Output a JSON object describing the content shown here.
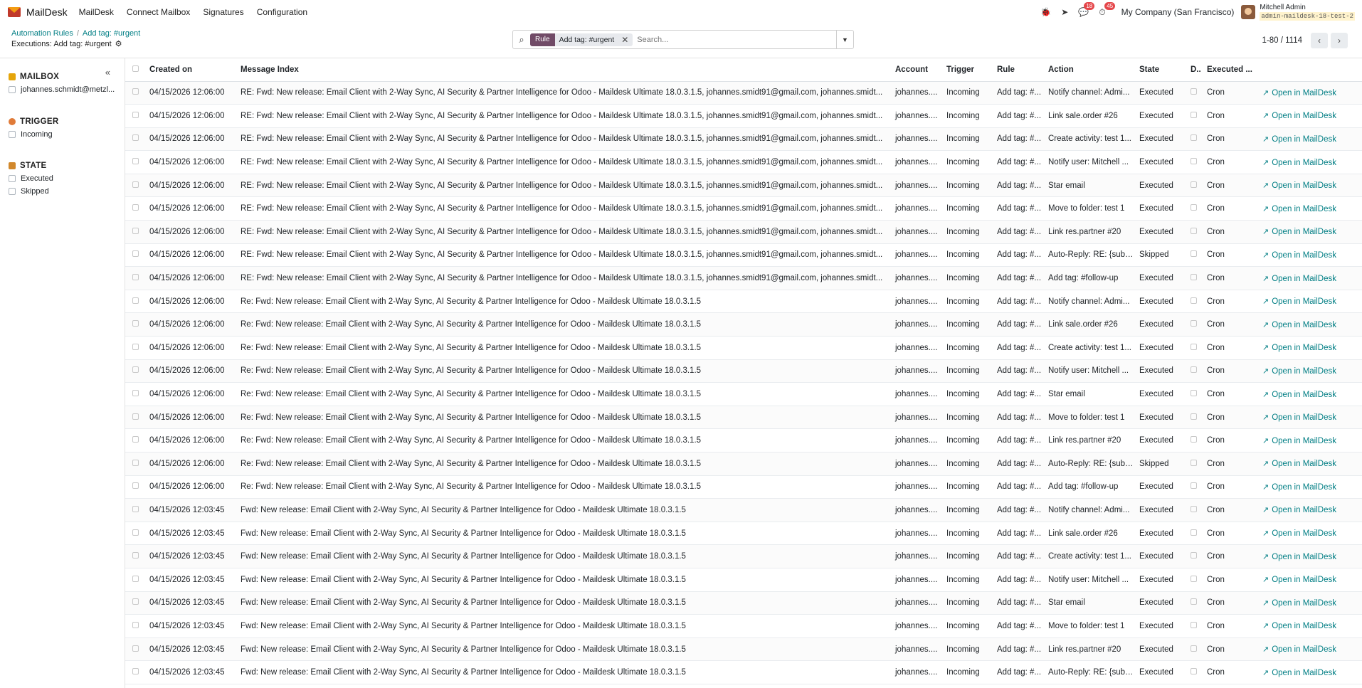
{
  "app": {
    "name": "MailDesk",
    "menu": [
      "MailDesk",
      "Connect Mailbox",
      "Signatures",
      "Configuration"
    ]
  },
  "systray": {
    "messages_count": "18",
    "activities_count": "45",
    "company": "My Company (San Francisco)",
    "user_name": "Mitchell Admin",
    "database": "admin-maildesk-18-test-2"
  },
  "breadcrumb": {
    "root": "Automation Rules",
    "current": "Add tag: #urgent"
  },
  "subtitle": "Executions: Add tag: #urgent",
  "search": {
    "facet_label": "Rule",
    "facet_value": "Add tag: #urgent",
    "placeholder": "Search..."
  },
  "pager": {
    "value": "1-80 / 1114"
  },
  "sidebar": {
    "mailbox_title": "MAILBOX",
    "mailbox_items": [
      "johannes.schmidt@metzl..."
    ],
    "trigger_title": "TRIGGER",
    "trigger_items": [
      "Incoming"
    ],
    "state_title": "STATE",
    "state_items": [
      "Executed",
      "Skipped"
    ]
  },
  "colors": {
    "accent": "#714b67",
    "link": "#017e84",
    "brand": "#c0392b"
  },
  "table": {
    "headers": {
      "created_on": "Created on",
      "message_index": "Message Index",
      "account": "Account",
      "trigger": "Trigger",
      "rule": "Rule",
      "action": "Action",
      "state": "State",
      "d": "D..",
      "executed": "Executed ..."
    },
    "open_label": "Open in MailDesk",
    "rows": [
      {
        "created": "04/15/2026 12:06:00",
        "msg": "RE: Fwd: New release: Email Client with 2-Way Sync, AI Security & Partner Intelligence for Odoo - Maildesk Ultimate 18.0.3.1.5, johannes.smidt91@gmail.com, johannes.smidt...",
        "account": "johannes....",
        "trigger": "Incoming",
        "rule": "Add tag: #...",
        "action": "Notify channel: Admi...",
        "state": "Executed",
        "exec": "Cron"
      },
      {
        "created": "04/15/2026 12:06:00",
        "msg": "RE: Fwd: New release: Email Client with 2-Way Sync, AI Security & Partner Intelligence for Odoo - Maildesk Ultimate 18.0.3.1.5, johannes.smidt91@gmail.com, johannes.smidt...",
        "account": "johannes....",
        "trigger": "Incoming",
        "rule": "Add tag: #...",
        "action": "Link sale.order #26",
        "state": "Executed",
        "exec": "Cron"
      },
      {
        "created": "04/15/2026 12:06:00",
        "msg": "RE: Fwd: New release: Email Client with 2-Way Sync, AI Security & Partner Intelligence for Odoo - Maildesk Ultimate 18.0.3.1.5, johannes.smidt91@gmail.com, johannes.smidt...",
        "account": "johannes....",
        "trigger": "Incoming",
        "rule": "Add tag: #...",
        "action": "Create activity: test 1...",
        "state": "Executed",
        "exec": "Cron"
      },
      {
        "created": "04/15/2026 12:06:00",
        "msg": "RE: Fwd: New release: Email Client with 2-Way Sync, AI Security & Partner Intelligence for Odoo - Maildesk Ultimate 18.0.3.1.5, johannes.smidt91@gmail.com, johannes.smidt...",
        "account": "johannes....",
        "trigger": "Incoming",
        "rule": "Add tag: #...",
        "action": "Notify user: Mitchell ...",
        "state": "Executed",
        "exec": "Cron"
      },
      {
        "created": "04/15/2026 12:06:00",
        "msg": "RE: Fwd: New release: Email Client with 2-Way Sync, AI Security & Partner Intelligence for Odoo - Maildesk Ultimate 18.0.3.1.5, johannes.smidt91@gmail.com, johannes.smidt...",
        "account": "johannes....",
        "trigger": "Incoming",
        "rule": "Add tag: #...",
        "action": "Star email",
        "state": "Executed",
        "exec": "Cron"
      },
      {
        "created": "04/15/2026 12:06:00",
        "msg": "RE: Fwd: New release: Email Client with 2-Way Sync, AI Security & Partner Intelligence for Odoo - Maildesk Ultimate 18.0.3.1.5, johannes.smidt91@gmail.com, johannes.smidt...",
        "account": "johannes....",
        "trigger": "Incoming",
        "rule": "Add tag: #...",
        "action": "Move to folder: test 1",
        "state": "Executed",
        "exec": "Cron"
      },
      {
        "created": "04/15/2026 12:06:00",
        "msg": "RE: Fwd: New release: Email Client with 2-Way Sync, AI Security & Partner Intelligence for Odoo - Maildesk Ultimate 18.0.3.1.5, johannes.smidt91@gmail.com, johannes.smidt...",
        "account": "johannes....",
        "trigger": "Incoming",
        "rule": "Add tag: #...",
        "action": "Link res.partner #20",
        "state": "Executed",
        "exec": "Cron"
      },
      {
        "created": "04/15/2026 12:06:00",
        "msg": "RE: Fwd: New release: Email Client with 2-Way Sync, AI Security & Partner Intelligence for Odoo - Maildesk Ultimate 18.0.3.1.5, johannes.smidt91@gmail.com, johannes.smidt...",
        "account": "johannes....",
        "trigger": "Incoming",
        "rule": "Add tag: #...",
        "action": "Auto-Reply: RE: {subj...",
        "state": "Skipped",
        "exec": "Cron"
      },
      {
        "created": "04/15/2026 12:06:00",
        "msg": "RE: Fwd: New release: Email Client with 2-Way Sync, AI Security & Partner Intelligence for Odoo - Maildesk Ultimate 18.0.3.1.5, johannes.smidt91@gmail.com, johannes.smidt...",
        "account": "johannes....",
        "trigger": "Incoming",
        "rule": "Add tag: #...",
        "action": "Add tag: #follow-up",
        "state": "Executed",
        "exec": "Cron"
      },
      {
        "created": "04/15/2026 12:06:00",
        "msg": "Re: Fwd: New release: Email Client with 2-Way Sync, AI Security & Partner Intelligence for Odoo - Maildesk Ultimate 18.0.3.1.5",
        "account": "johannes....",
        "trigger": "Incoming",
        "rule": "Add tag: #...",
        "action": "Notify channel: Admi...",
        "state": "Executed",
        "exec": "Cron"
      },
      {
        "created": "04/15/2026 12:06:00",
        "msg": "Re: Fwd: New release: Email Client with 2-Way Sync, AI Security & Partner Intelligence for Odoo - Maildesk Ultimate 18.0.3.1.5",
        "account": "johannes....",
        "trigger": "Incoming",
        "rule": "Add tag: #...",
        "action": "Link sale.order #26",
        "state": "Executed",
        "exec": "Cron"
      },
      {
        "created": "04/15/2026 12:06:00",
        "msg": "Re: Fwd: New release: Email Client with 2-Way Sync, AI Security & Partner Intelligence for Odoo - Maildesk Ultimate 18.0.3.1.5",
        "account": "johannes....",
        "trigger": "Incoming",
        "rule": "Add tag: #...",
        "action": "Create activity: test 1...",
        "state": "Executed",
        "exec": "Cron"
      },
      {
        "created": "04/15/2026 12:06:00",
        "msg": "Re: Fwd: New release: Email Client with 2-Way Sync, AI Security & Partner Intelligence for Odoo - Maildesk Ultimate 18.0.3.1.5",
        "account": "johannes....",
        "trigger": "Incoming",
        "rule": "Add tag: #...",
        "action": "Notify user: Mitchell ...",
        "state": "Executed",
        "exec": "Cron"
      },
      {
        "created": "04/15/2026 12:06:00",
        "msg": "Re: Fwd: New release: Email Client with 2-Way Sync, AI Security & Partner Intelligence for Odoo - Maildesk Ultimate 18.0.3.1.5",
        "account": "johannes....",
        "trigger": "Incoming",
        "rule": "Add tag: #...",
        "action": "Star email",
        "state": "Executed",
        "exec": "Cron"
      },
      {
        "created": "04/15/2026 12:06:00",
        "msg": "Re: Fwd: New release: Email Client with 2-Way Sync, AI Security & Partner Intelligence for Odoo - Maildesk Ultimate 18.0.3.1.5",
        "account": "johannes....",
        "trigger": "Incoming",
        "rule": "Add tag: #...",
        "action": "Move to folder: test 1",
        "state": "Executed",
        "exec": "Cron"
      },
      {
        "created": "04/15/2026 12:06:00",
        "msg": "Re: Fwd: New release: Email Client with 2-Way Sync, AI Security & Partner Intelligence for Odoo - Maildesk Ultimate 18.0.3.1.5",
        "account": "johannes....",
        "trigger": "Incoming",
        "rule": "Add tag: #...",
        "action": "Link res.partner #20",
        "state": "Executed",
        "exec": "Cron"
      },
      {
        "created": "04/15/2026 12:06:00",
        "msg": "Re: Fwd: New release: Email Client with 2-Way Sync, AI Security & Partner Intelligence for Odoo - Maildesk Ultimate 18.0.3.1.5",
        "account": "johannes....",
        "trigger": "Incoming",
        "rule": "Add tag: #...",
        "action": "Auto-Reply: RE: {subj...",
        "state": "Skipped",
        "exec": "Cron"
      },
      {
        "created": "04/15/2026 12:06:00",
        "msg": "Re: Fwd: New release: Email Client with 2-Way Sync, AI Security & Partner Intelligence for Odoo - Maildesk Ultimate 18.0.3.1.5",
        "account": "johannes....",
        "trigger": "Incoming",
        "rule": "Add tag: #...",
        "action": "Add tag: #follow-up",
        "state": "Executed",
        "exec": "Cron"
      },
      {
        "created": "04/15/2026 12:03:45",
        "msg": "Fwd: New release: Email Client with 2-Way Sync, AI Security & Partner Intelligence for Odoo - Maildesk Ultimate 18.0.3.1.5",
        "account": "johannes....",
        "trigger": "Incoming",
        "rule": "Add tag: #...",
        "action": "Notify channel: Admi...",
        "state": "Executed",
        "exec": "Cron"
      },
      {
        "created": "04/15/2026 12:03:45",
        "msg": "Fwd: New release: Email Client with 2-Way Sync, AI Security & Partner Intelligence for Odoo - Maildesk Ultimate 18.0.3.1.5",
        "account": "johannes....",
        "trigger": "Incoming",
        "rule": "Add tag: #...",
        "action": "Link sale.order #26",
        "state": "Executed",
        "exec": "Cron"
      },
      {
        "created": "04/15/2026 12:03:45",
        "msg": "Fwd: New release: Email Client with 2-Way Sync, AI Security & Partner Intelligence for Odoo - Maildesk Ultimate 18.0.3.1.5",
        "account": "johannes....",
        "trigger": "Incoming",
        "rule": "Add tag: #...",
        "action": "Create activity: test 1...",
        "state": "Executed",
        "exec": "Cron"
      },
      {
        "created": "04/15/2026 12:03:45",
        "msg": "Fwd: New release: Email Client with 2-Way Sync, AI Security & Partner Intelligence for Odoo - Maildesk Ultimate 18.0.3.1.5",
        "account": "johannes....",
        "trigger": "Incoming",
        "rule": "Add tag: #...",
        "action": "Notify user: Mitchell ...",
        "state": "Executed",
        "exec": "Cron"
      },
      {
        "created": "04/15/2026 12:03:45",
        "msg": "Fwd: New release: Email Client with 2-Way Sync, AI Security & Partner Intelligence for Odoo - Maildesk Ultimate 18.0.3.1.5",
        "account": "johannes....",
        "trigger": "Incoming",
        "rule": "Add tag: #...",
        "action": "Star email",
        "state": "Executed",
        "exec": "Cron"
      },
      {
        "created": "04/15/2026 12:03:45",
        "msg": "Fwd: New release: Email Client with 2-Way Sync, AI Security & Partner Intelligence for Odoo - Maildesk Ultimate 18.0.3.1.5",
        "account": "johannes....",
        "trigger": "Incoming",
        "rule": "Add tag: #...",
        "action": "Move to folder: test 1",
        "state": "Executed",
        "exec": "Cron"
      },
      {
        "created": "04/15/2026 12:03:45",
        "msg": "Fwd: New release: Email Client with 2-Way Sync, AI Security & Partner Intelligence for Odoo - Maildesk Ultimate 18.0.3.1.5",
        "account": "johannes....",
        "trigger": "Incoming",
        "rule": "Add tag: #...",
        "action": "Link res.partner #20",
        "state": "Executed",
        "exec": "Cron"
      },
      {
        "created": "04/15/2026 12:03:45",
        "msg": "Fwd: New release: Email Client with 2-Way Sync, AI Security & Partner Intelligence for Odoo - Maildesk Ultimate 18.0.3.1.5",
        "account": "johannes....",
        "trigger": "Incoming",
        "rule": "Add tag: #...",
        "action": "Auto-Reply: RE: {subj...",
        "state": "Executed",
        "exec": "Cron"
      }
    ]
  }
}
